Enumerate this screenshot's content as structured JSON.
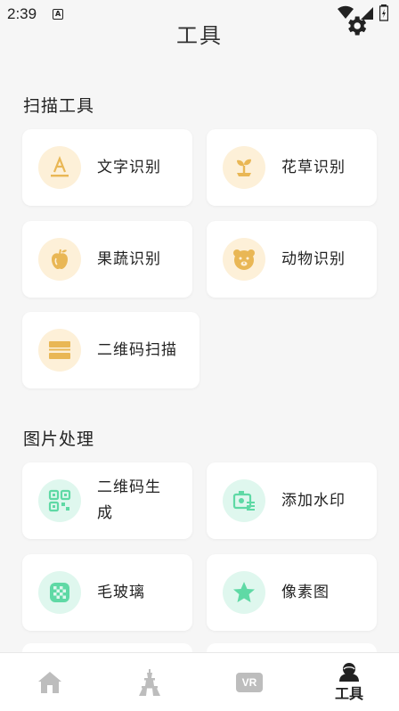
{
  "status_bar": {
    "time": "2:39",
    "notification_badge": "A"
  },
  "header": {
    "title": "工具",
    "settings_icon": "gear-icon"
  },
  "sections": [
    {
      "title": "扫描工具",
      "items": [
        {
          "label": "文字识别",
          "icon": "text-recognition-icon",
          "color": "yellow"
        },
        {
          "label": "花草识别",
          "icon": "sprout-icon",
          "color": "yellow"
        },
        {
          "label": "果蔬识别",
          "icon": "apple-icon",
          "color": "yellow"
        },
        {
          "label": "动物识别",
          "icon": "bear-icon",
          "color": "yellow"
        },
        {
          "label": "二维码扫描",
          "icon": "scan-icon",
          "color": "yellow"
        }
      ]
    },
    {
      "title": "图片处理",
      "items": [
        {
          "label": "二维码生成",
          "line1": "二维码生",
          "line2": "成",
          "icon": "qr-code-icon",
          "color": "green"
        },
        {
          "label": "添加水印",
          "icon": "watermark-icon",
          "color": "green"
        },
        {
          "label": "毛玻璃",
          "icon": "frosted-glass-icon",
          "color": "green"
        },
        {
          "label": "像素图",
          "icon": "star-icon",
          "color": "green"
        }
      ]
    }
  ],
  "bottom_nav": {
    "items": [
      {
        "icon": "home-icon",
        "label": ""
      },
      {
        "icon": "tower-icon",
        "label": ""
      },
      {
        "icon": "vr-icon",
        "label": "",
        "badge": "VR"
      },
      {
        "icon": "user-icon",
        "label": "工具",
        "active": true
      }
    ]
  },
  "colors": {
    "yellow_icon": "#e9b755",
    "green_icon": "#5fd9a5",
    "yellow_bg": "#fdf0d8",
    "green_bg": "#dff7ee"
  }
}
